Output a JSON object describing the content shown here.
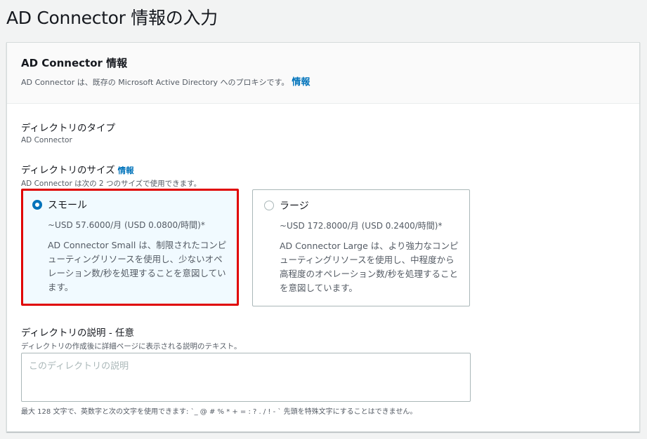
{
  "page": {
    "title": "AD Connector 情報の入力"
  },
  "panel": {
    "heading": "AD Connector 情報",
    "description": "AD Connector は、既存の Microsoft Active Directory へのプロキシです。",
    "info_link": "情報"
  },
  "directory_type": {
    "label": "ディレクトリのタイプ",
    "value": "AD Connector"
  },
  "directory_size": {
    "label": "ディレクトリのサイズ",
    "info_link": "情報",
    "hint": "AD Connector は次の 2 つのサイズで使用できます。",
    "options": [
      {
        "title": "スモール",
        "price": "~USD 57.6000/月 (USD 0.0800/時間)*",
        "description": "AD Connector Small は、制限されたコンピューティングリソースを使用し、少ないオペレーション数/秒を処理することを意図しています。",
        "selected": true
      },
      {
        "title": "ラージ",
        "price": "~USD 172.8000/月 (USD 0.2400/時間)*",
        "description": "AD Connector Large は、より強力なコンピューティングリソースを使用し、中程度から高程度のオペレーション数/秒を処理することを意図しています。",
        "selected": false
      }
    ]
  },
  "directory_description": {
    "label": "ディレクトリの説明 - 任意",
    "hint": "ディレクトリの作成後に詳細ページに表示される説明のテキスト。",
    "placeholder": "このディレクトリの説明",
    "value": "",
    "constraint": "最大 128 文字で、英数字と次の文字を使用できます: `_ @ # % * + = : ? . / ! - ` 先頭を特殊文字にすることはできません。"
  },
  "colors": {
    "accent": "#0073bb",
    "selection_highlight": "#e00000",
    "selected_tile_bg": "#f1faff"
  }
}
